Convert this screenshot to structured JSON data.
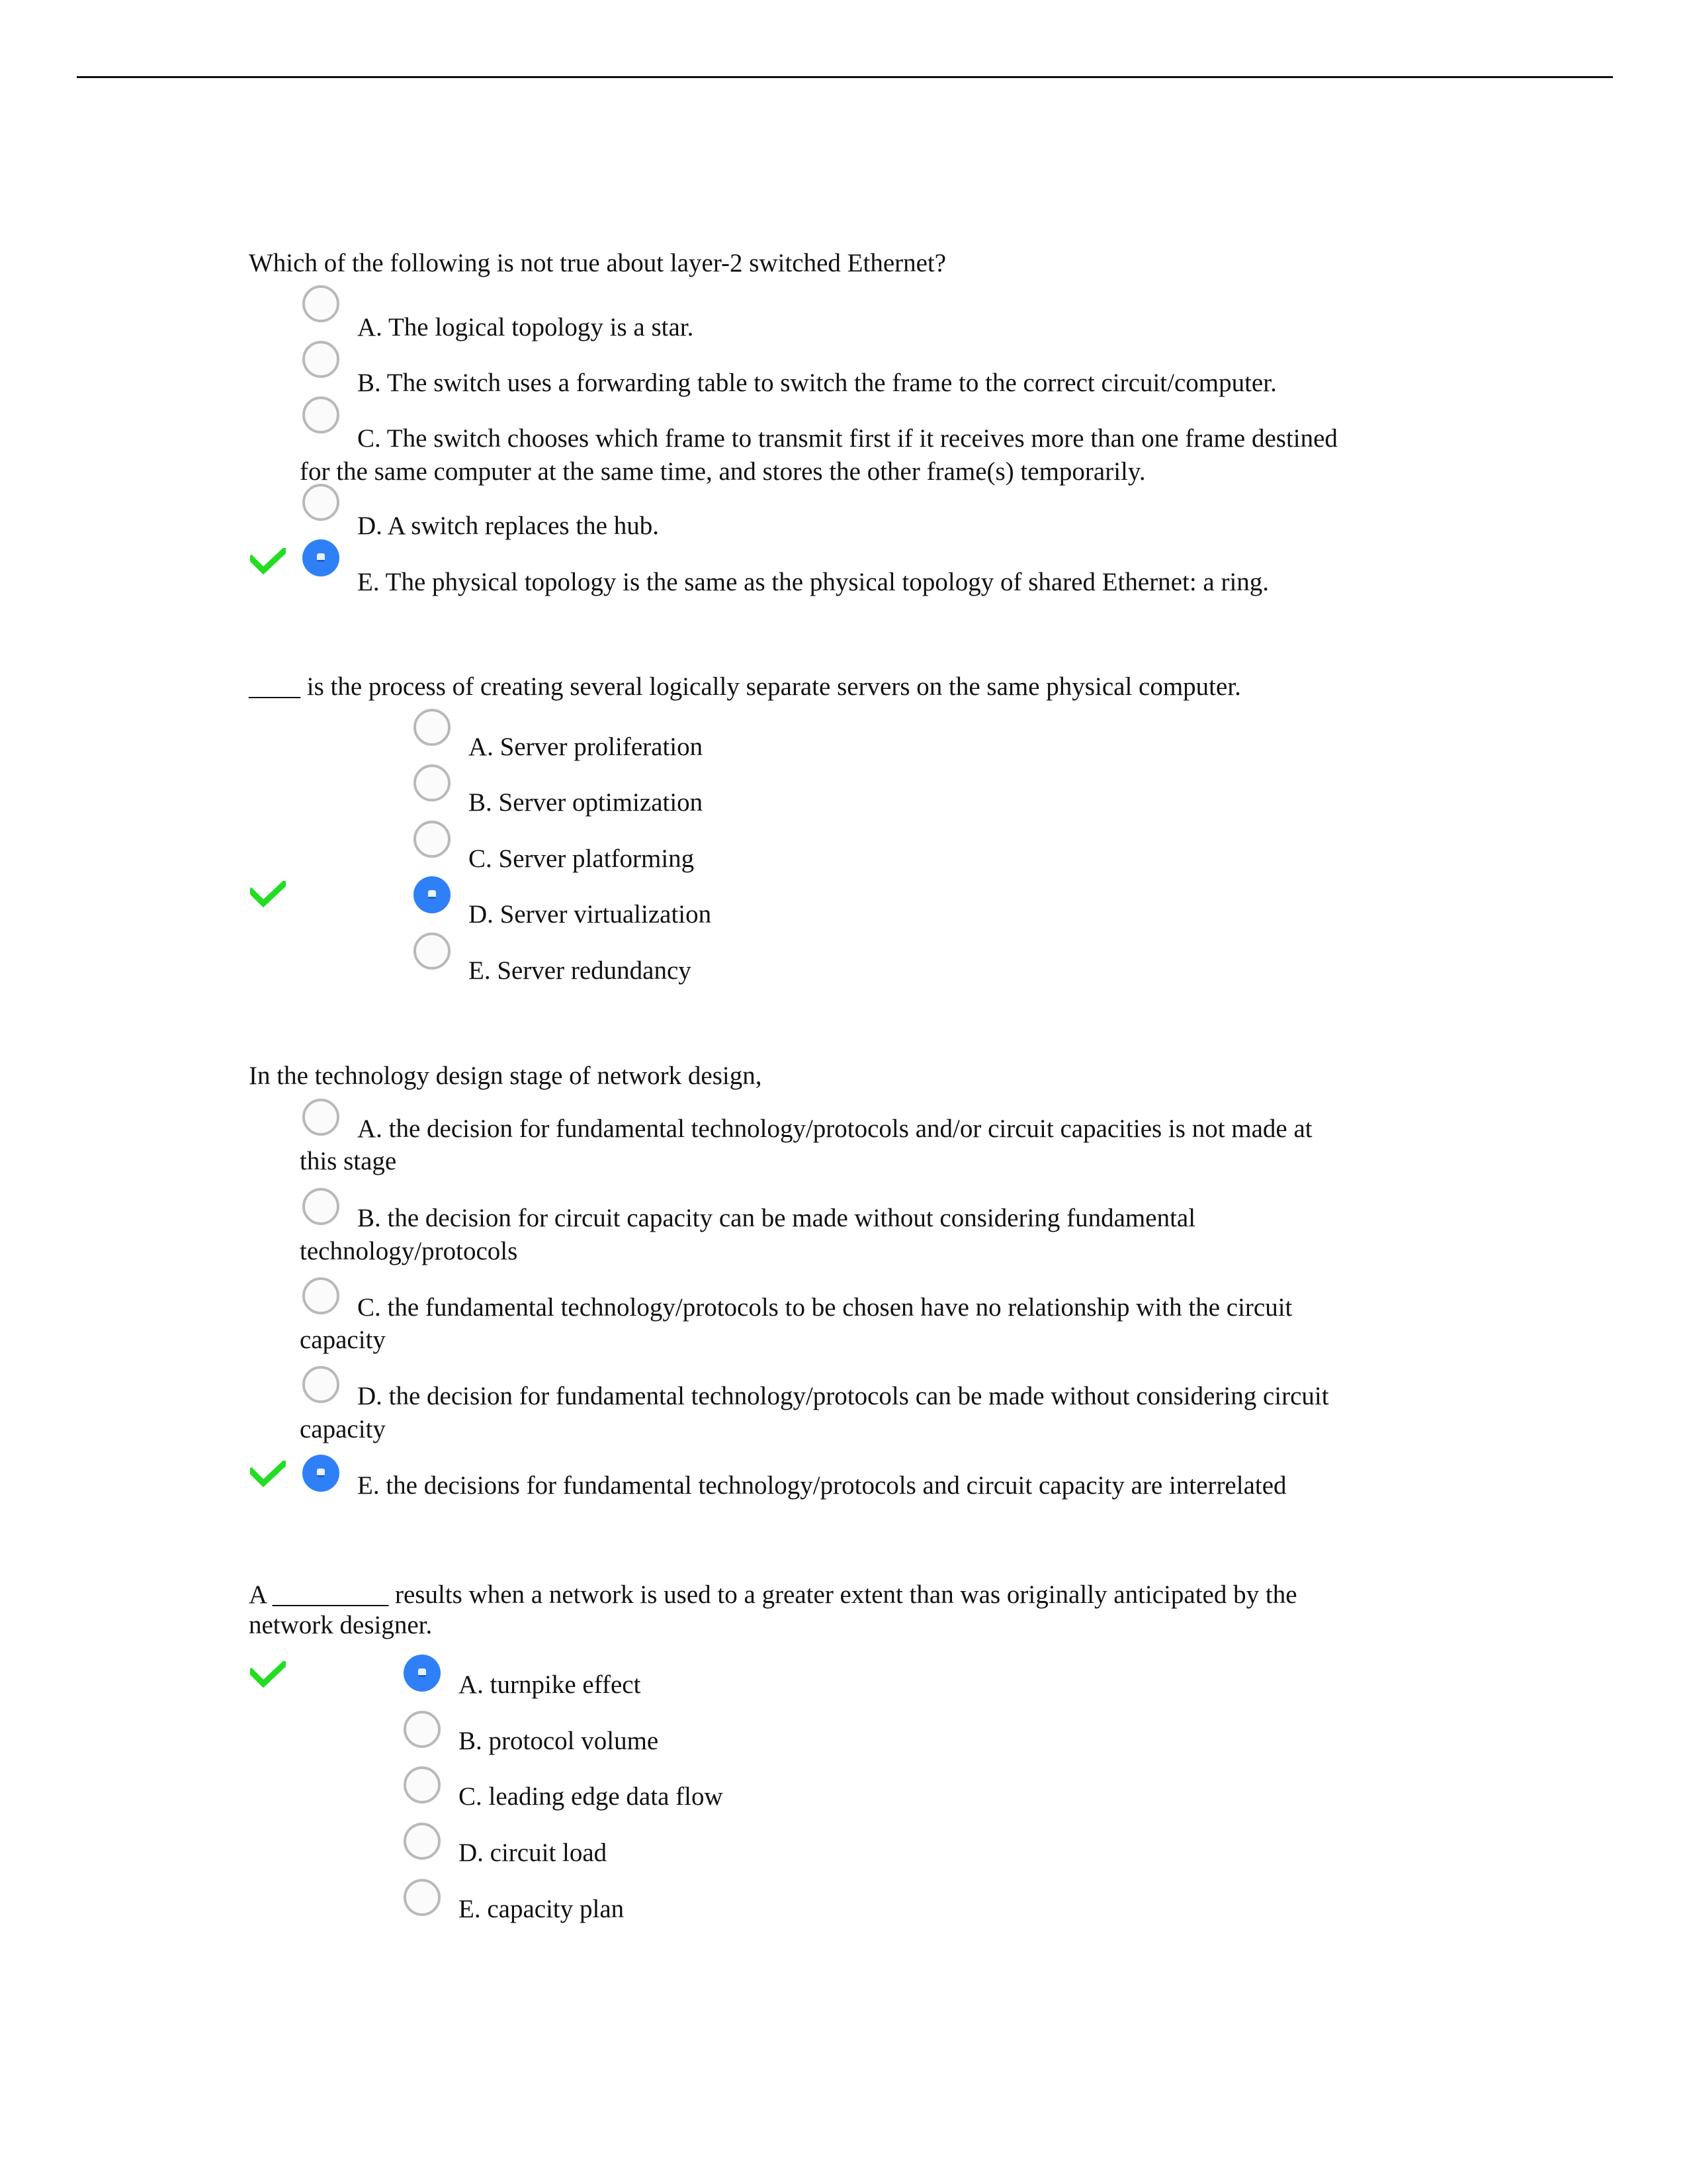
{
  "theme": {
    "check_color": "#22dd22",
    "selected_radio_color": "#2f80f6",
    "radio_border_color": "#b9b9b9"
  },
  "questions": [
    {
      "prompt_lines": [
        "Which of the following is not true about layer-2 switched Ethernet?"
      ],
      "selected": "E",
      "marked_correct": true,
      "options": [
        {
          "letter": "A",
          "lines": [
            "A. The logical topology is a star."
          ]
        },
        {
          "letter": "B",
          "lines": [
            "B. The switch uses a forwarding table to switch the frame to the correct circuit/computer."
          ]
        },
        {
          "letter": "C",
          "lines": [
            "C. The switch chooses which frame to transmit first if it receives more than one frame destined",
            "for the same computer at the same time, and stores the other frame(s) temporarily."
          ]
        },
        {
          "letter": "D",
          "lines": [
            "D. A switch replaces the hub."
          ]
        },
        {
          "letter": "E",
          "lines": [
            "E. The physical topology is the same as the physical topology of shared Ethernet: a ring."
          ]
        }
      ]
    },
    {
      "prompt_lines": [
        "____ is the process of creating several logically separate servers on the same physical computer."
      ],
      "selected": "D",
      "marked_correct": true,
      "options": [
        {
          "letter": "A",
          "lines": [
            "A. Server proliferation"
          ]
        },
        {
          "letter": "B",
          "lines": [
            "B. Server optimization"
          ]
        },
        {
          "letter": "C",
          "lines": [
            "C. Server platforming"
          ]
        },
        {
          "letter": "D",
          "lines": [
            "D. Server virtualization"
          ]
        },
        {
          "letter": "E",
          "lines": [
            "E. Server redundancy"
          ]
        }
      ]
    },
    {
      "prompt_lines": [
        "In the technology design stage of network design,"
      ],
      "selected": "E",
      "marked_correct": true,
      "options": [
        {
          "letter": "A",
          "lines": [
            "A. the decision for fundamental technology/protocols and/or circuit capacities is not made at",
            "this stage"
          ]
        },
        {
          "letter": "B",
          "lines": [
            "B. the decision for circuit capacity can be made without considering fundamental",
            "technology/protocols"
          ]
        },
        {
          "letter": "C",
          "lines": [
            "C. the fundamental technology/protocols to be chosen have no relationship with the circuit",
            "capacity"
          ]
        },
        {
          "letter": "D",
          "lines": [
            "D. the decision for fundamental technology/protocols can be made without considering circuit",
            "capacity"
          ]
        },
        {
          "letter": "E",
          "lines": [
            "E. the decisions for fundamental technology/protocols and circuit capacity are interrelated"
          ]
        }
      ]
    },
    {
      "prompt_lines": [
        "A _________ results when a network is used to a greater extent than was originally anticipated by the",
        "network designer."
      ],
      "selected": "A",
      "marked_correct": true,
      "options": [
        {
          "letter": "A",
          "lines": [
            "A. turnpike effect"
          ]
        },
        {
          "letter": "B",
          "lines": [
            "B. protocol volume"
          ]
        },
        {
          "letter": "C",
          "lines": [
            "C. leading edge data flow"
          ]
        },
        {
          "letter": "D",
          "lines": [
            "D. circuit load"
          ]
        },
        {
          "letter": "E",
          "lines": [
            "E. capacity plan"
          ]
        }
      ]
    }
  ]
}
